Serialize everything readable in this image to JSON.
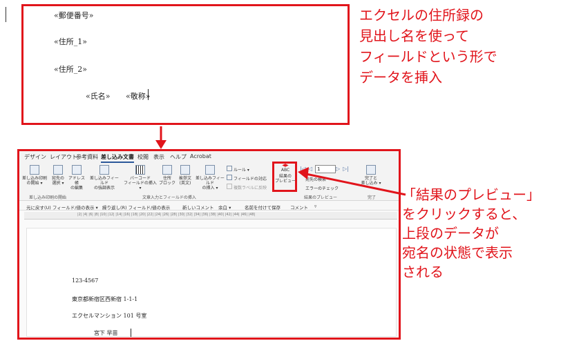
{
  "top_document": {
    "fields": [
      "«郵便番号»",
      "«住所_1»",
      "«住所_2»",
      "«氏名»",
      "«敬称»"
    ]
  },
  "annotation_top": [
    "エクセルの住所録の",
    "見出し名を使って",
    "フィールドという形で",
    "データを挿入"
  ],
  "annotation_bottom": [
    "「結果のプレビュー」",
    "をクリックすると、",
    "上段のデータが",
    "宛名の状態で表示",
    "される"
  ],
  "ribbon": {
    "tabs": [
      "デザイン",
      "レイアウト",
      "参考資料",
      "差し込み文書",
      "校閲",
      "表示",
      "ヘルプ",
      "Acrobat"
    ],
    "active_tab": "差し込み文書",
    "buttons": [
      {
        "l1": "差し込み印刷",
        "l2": "の開始 ▾"
      },
      {
        "l1": "宛先の",
        "l2": "選択 ▾"
      },
      {
        "l1": "アドレス帳",
        "l2": "の編集"
      },
      {
        "l1": "差し込みフィールド",
        "l2": "の強調表示"
      },
      {
        "l1": "バーコード",
        "l2": "フィールドの挿入 ▾"
      },
      {
        "l1": "住所",
        "l2": "ブロック"
      },
      {
        "l1": "挨拶文",
        "l2": "(英文)"
      },
      {
        "l1": "差し込みフィールド",
        "l2": "の挿入 ▾"
      },
      {
        "l1": "結果の",
        "l2": "プレビュー"
      },
      {
        "l1": "完了と",
        "l2": "差し込み ▾"
      }
    ],
    "small_items": [
      "ルール ▾",
      "フィールドの対応",
      "複数ラベルに反映"
    ],
    "preview_icon_text": "ABC",
    "record_number": "1",
    "nav_items": [
      "宛先の検索",
      "エラーのチェック"
    ],
    "groups": [
      "差し込み印刷の開始",
      "文章入力とフィールドの挿入",
      "結果のプレビュー",
      "完了"
    ]
  },
  "toolbar2": [
    "元に戻す(U) フィールド/値の表示 ▾",
    "繰り返し(R) フィールド/値の表示",
    "新しいコメント",
    "余白 ▾",
    "名前を付けて保存",
    "コメント",
    "▿"
  ],
  "ruler_text": "|2| |4| |6| |8| |10| |12| |14| |16| |18| |20| |22| |24| |26| |28| |30| |32| |34| |36| |38| |40| |42| |44| |46| |48|",
  "preview_document": {
    "postal": "123-4567",
    "address1": "東京都新宿区西新宿 1-1-1",
    "address2": "エクセルマンション 101 号室",
    "name_line": "宮下  早苗"
  }
}
